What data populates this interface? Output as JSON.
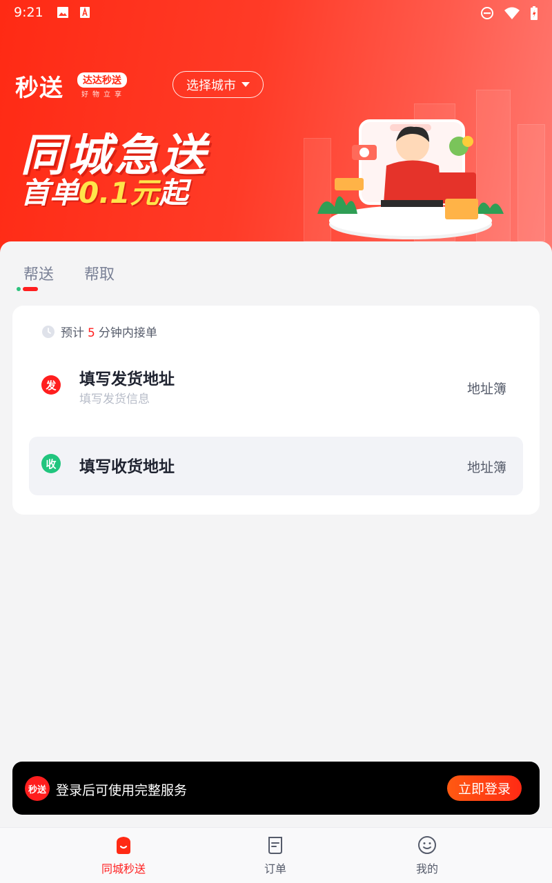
{
  "status_bar": {
    "time": "9:21",
    "left_icons": [
      "image-icon",
      "app-notification-icon"
    ],
    "right_icons": [
      "do-not-disturb-icon",
      "wifi-icon",
      "battery-charging-icon"
    ]
  },
  "header": {
    "logo_main": "秒送",
    "logo_badge": "达达秒送",
    "logo_sub": "好物立享",
    "city_selector": "选择城市"
  },
  "banner": {
    "title": "同城急送",
    "subtitle_prefix": "首单",
    "subtitle_highlight": "0.1元",
    "subtitle_suffix": "起"
  },
  "tabs": [
    {
      "label": "帮送",
      "active": true
    },
    {
      "label": "帮取",
      "active": false
    }
  ],
  "order_card": {
    "eta_prefix": "预计",
    "eta_minutes": "5",
    "eta_suffix": "分钟内接单",
    "send": {
      "badge": "发",
      "title": "填写发货地址",
      "subtitle": "填写发货信息",
      "address_book": "地址簿"
    },
    "receive": {
      "badge": "收",
      "title": "填写收货地址",
      "address_book": "地址簿"
    }
  },
  "login_bar": {
    "logo": "秒送",
    "message": "登录后可使用完整服务",
    "button": "立即登录"
  },
  "bottom_nav": [
    {
      "label": "同城秒送",
      "icon": "home-bag-icon",
      "active": true
    },
    {
      "label": "订单",
      "icon": "order-list-icon",
      "active": false
    },
    {
      "label": "我的",
      "icon": "smiley-profile-icon",
      "active": false
    }
  ],
  "colors": {
    "brand_red": "#ff1e1e",
    "receive_green": "#21c57e",
    "highlight_yellow": "#ffe54a"
  }
}
